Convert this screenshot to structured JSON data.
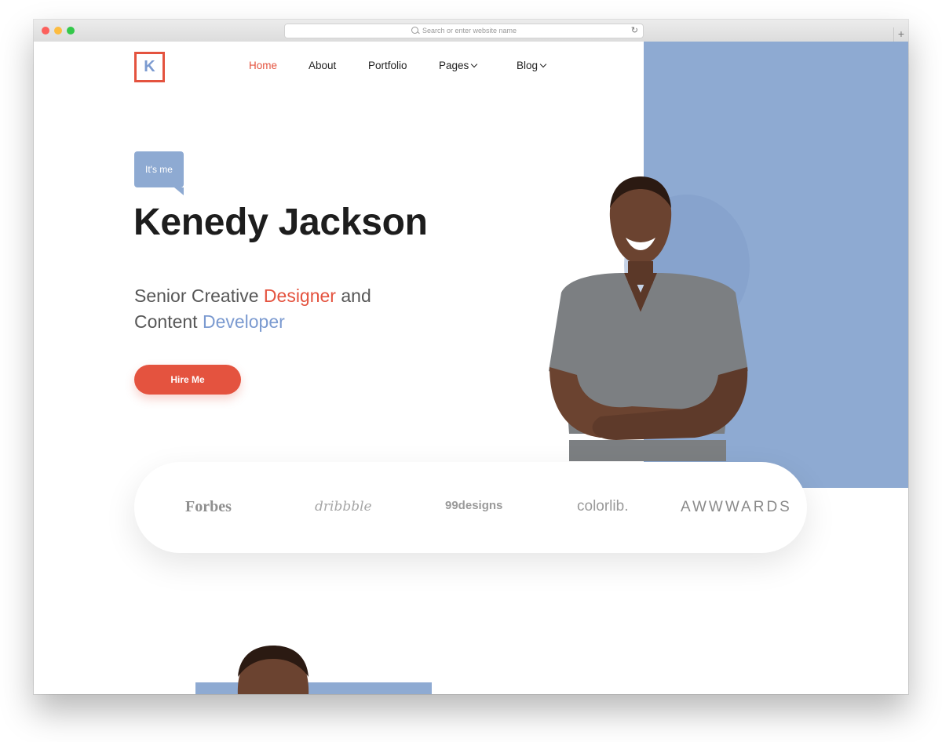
{
  "browser": {
    "url_placeholder": "Search or enter website name",
    "new_tab_label": "+"
  },
  "logo": {
    "letter": "K"
  },
  "nav": {
    "items": [
      {
        "label": "Home",
        "active": true
      },
      {
        "label": "About"
      },
      {
        "label": "Portfolio"
      },
      {
        "label": "Pages",
        "dropdown": true
      },
      {
        "label": "Blog",
        "dropdown": true
      }
    ]
  },
  "hero": {
    "badge": "It's me",
    "name": "Kenedy Jackson",
    "line1_prefix": "Senior Creative ",
    "line1_highlight": "Designer",
    "line1_suffix": " and",
    "line2_prefix": "Content ",
    "line2_highlight": "Developer",
    "cta_label": "Hire Me"
  },
  "brands": [
    "Forbes",
    "dribbble",
    "99designs",
    "colorlib.",
    "AWWWARDS"
  ],
  "colors": {
    "accent_red": "#e4533f",
    "accent_blue": "#8eaad2",
    "text_dark": "#1d1d1d"
  },
  "icons": {
    "search": "search-icon",
    "reload": "reload-icon",
    "chevron": "chevron-down-icon"
  }
}
